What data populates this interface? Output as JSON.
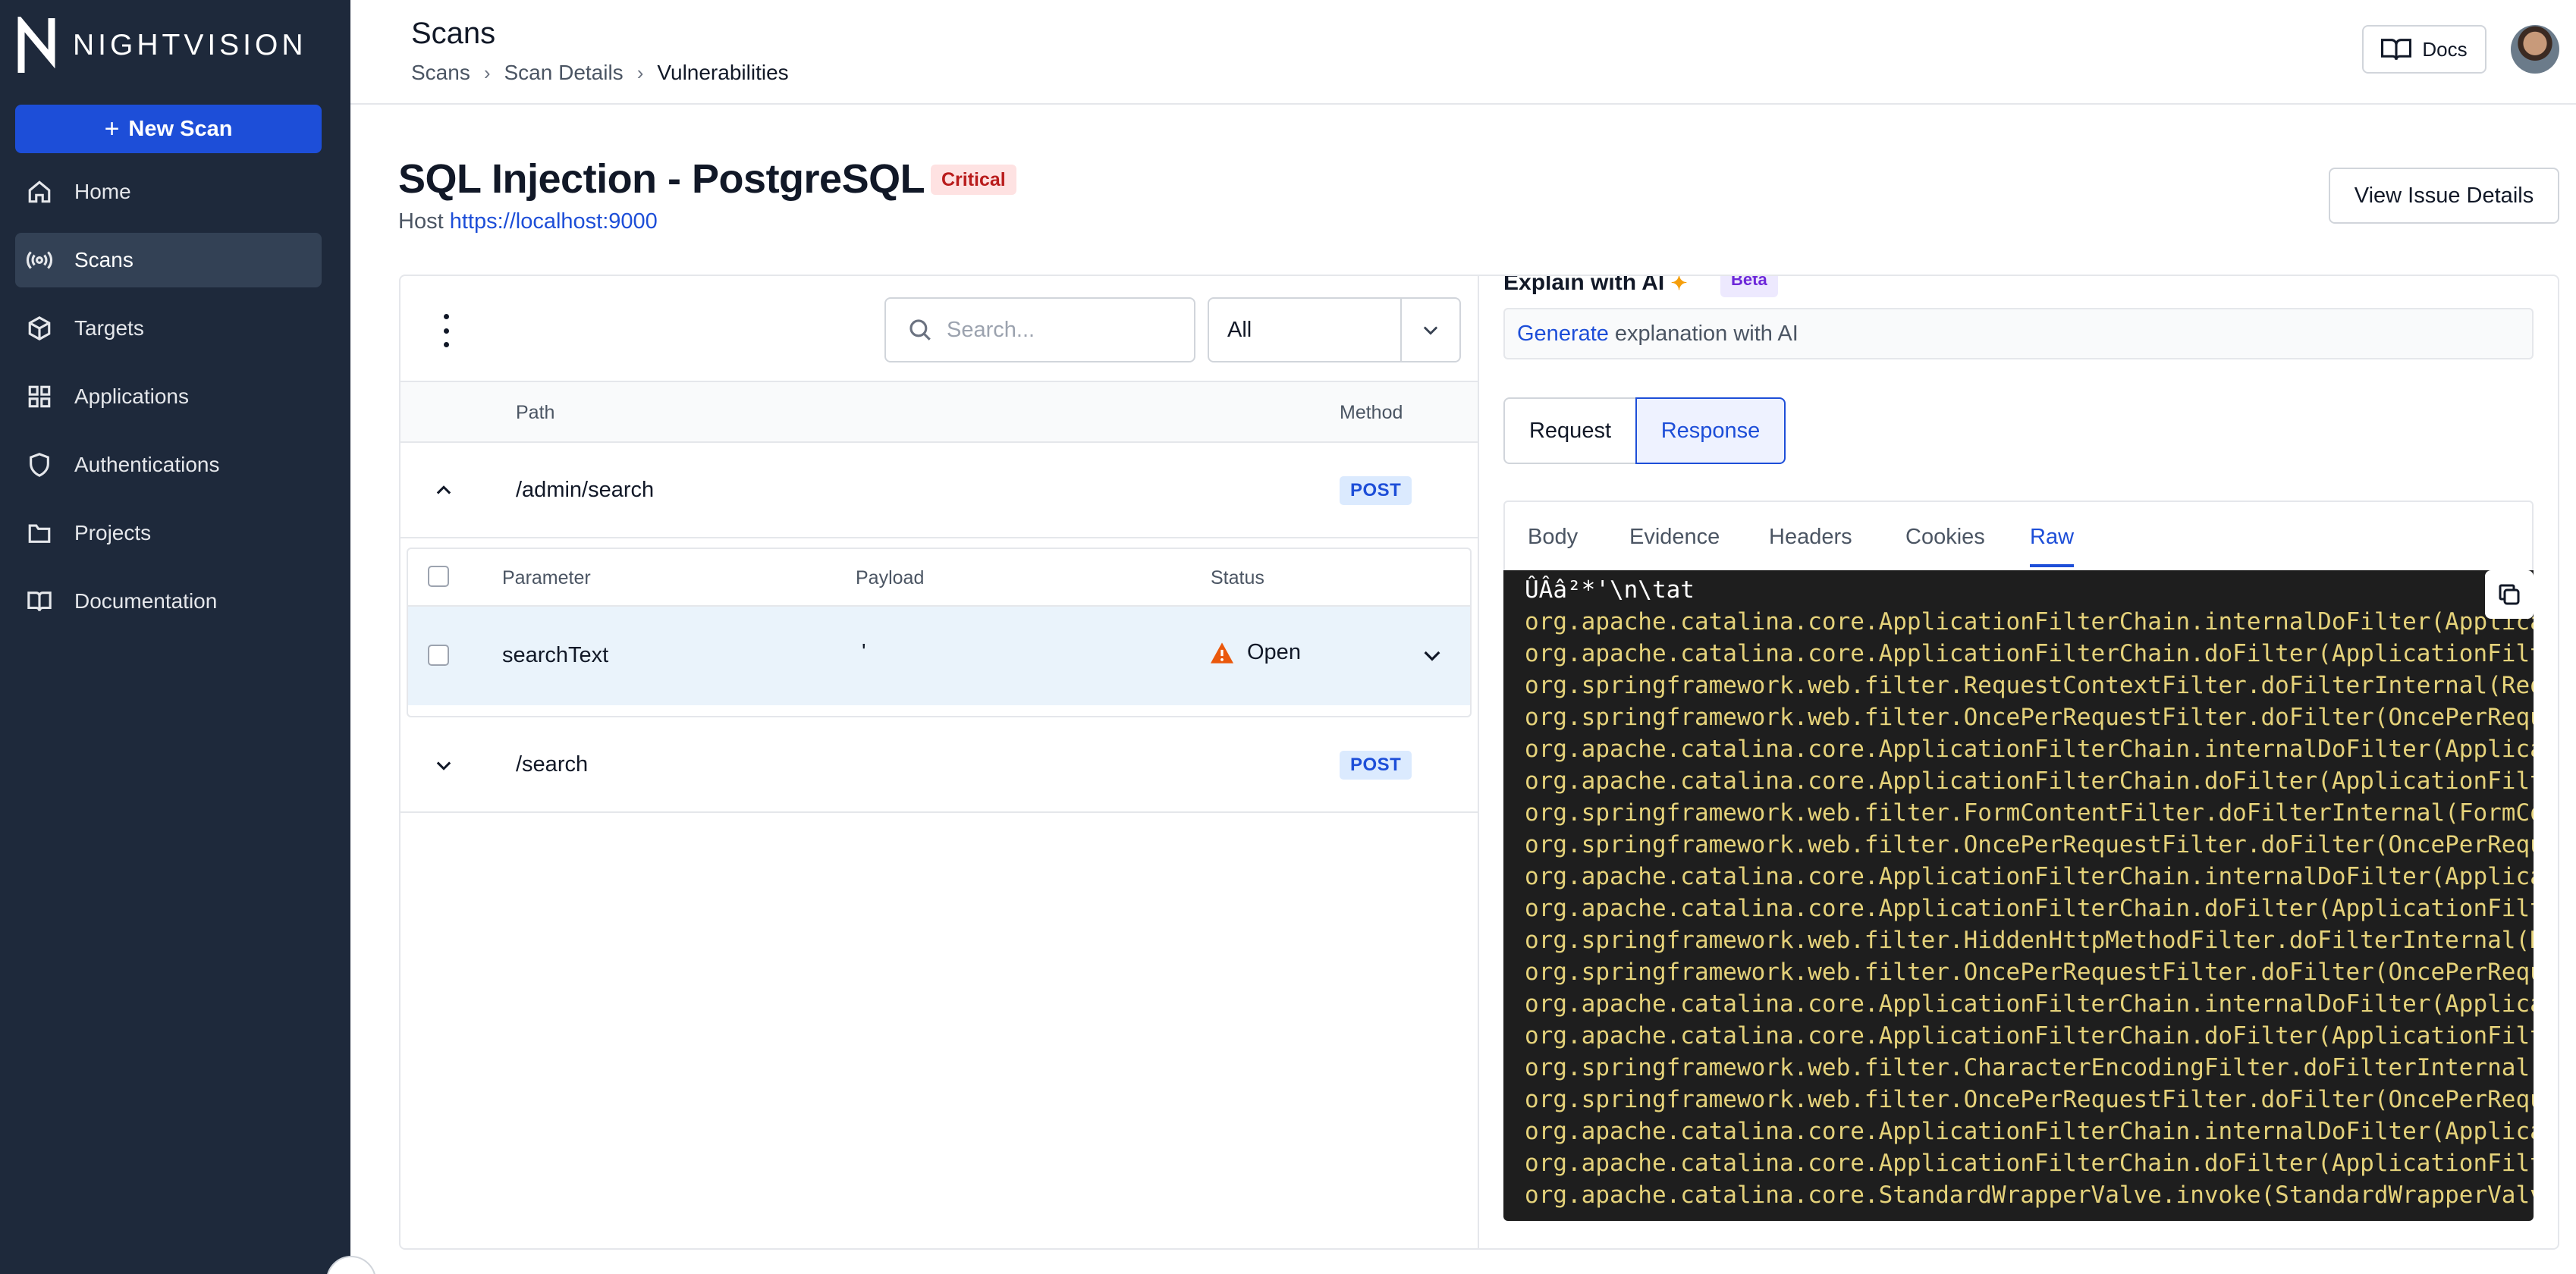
{
  "brand": {
    "name": "NIGHTVISION"
  },
  "sidebar": {
    "new_scan_label": "New Scan",
    "items": [
      {
        "label": "Home",
        "icon": "home-icon"
      },
      {
        "label": "Scans",
        "icon": "broadcast-icon",
        "active": true
      },
      {
        "label": "Targets",
        "icon": "cube-icon"
      },
      {
        "label": "Applications",
        "icon": "grid-icon"
      },
      {
        "label": "Authentications",
        "icon": "shield-icon"
      },
      {
        "label": "Projects",
        "icon": "folder-icon"
      },
      {
        "label": "Documentation",
        "icon": "book-icon"
      }
    ]
  },
  "header": {
    "title": "Scans",
    "breadcrumb": [
      "Scans",
      "Scan Details",
      "Vulnerabilities"
    ],
    "docs_label": "Docs"
  },
  "issue": {
    "title": "SQL Injection - PostgreSQL",
    "severity": "Critical",
    "host_label": "Host",
    "host_url": "https://localhost:9000",
    "view_details_label": "View Issue Details"
  },
  "paths_panel": {
    "search_placeholder": "Search...",
    "filter_value": "All",
    "columns": {
      "path": "Path",
      "method": "Method"
    },
    "rows": [
      {
        "path": "/admin/search",
        "method": "POST",
        "expanded": true
      },
      {
        "path": "/search",
        "method": "POST",
        "expanded": false
      }
    ],
    "sub_columns": {
      "parameter": "Parameter",
      "payload": "Payload",
      "status": "Status"
    },
    "sub_rows": [
      {
        "parameter": "searchText",
        "payload": "'",
        "status": "Open"
      }
    ]
  },
  "detail_panel": {
    "explain_title": "Explain with AI",
    "beta_label": "Beta",
    "generate_link": "Generate",
    "generate_rest": "explanation with AI",
    "toggle": [
      "Request",
      "Response"
    ],
    "active_toggle": "Response",
    "tabs": [
      "Body",
      "Evidence",
      "Headers",
      "Cookies",
      "Raw"
    ],
    "active_tab": "Raw",
    "raw_lines": [
      "ÛÂâ²*'\\n\\tat",
      "org.apache.catalina.core.ApplicationFilterChain.internalDoFilter(ApplicationFil",
      "org.apache.catalina.core.ApplicationFilterChain.doFilter(ApplicationFilterChain",
      "org.springframework.web.filter.RequestContextFilter.doFilterInternal(RequestCon",
      "org.springframework.web.filter.OncePerRequestFilter.doFilter(OncePerRequestFilt",
      "org.apache.catalina.core.ApplicationFilterChain.internalDoFilter(ApplicationFil",
      "org.apache.catalina.core.ApplicationFilterChain.doFilter(ApplicationFilterChain",
      "org.springframework.web.filter.FormContentFilter.doFilterInternal(FormContentFi",
      "org.springframework.web.filter.OncePerRequestFilter.doFilter(OncePerRequestFilt",
      "org.apache.catalina.core.ApplicationFilterChain.internalDoFilter(ApplicationFil",
      "org.apache.catalina.core.ApplicationFilterChain.doFilter(ApplicationFilterChain",
      "org.springframework.web.filter.HiddenHttpMethodFilter.doFilterInternal(HiddenHt",
      "org.springframework.web.filter.OncePerRequestFilter.doFilter(OncePerRequestFilt",
      "org.apache.catalina.core.ApplicationFilterChain.internalDoFilter(ApplicationFil",
      "org.apache.catalina.core.ApplicationFilterChain.doFilter(ApplicationFilterChain",
      "org.springframework.web.filter.CharacterEncodingFilter.doFilterInternal(Charact",
      "org.springframework.web.filter.OncePerRequestFilter.doFilter(OncePerRequestFilt",
      "org.apache.catalina.core.ApplicationFilterChain.internalDoFilter(ApplicationFil",
      "org.apache.catalina.core.ApplicationFilterChain.doFilter(ApplicationFilterChain",
      "org.apache.catalina.core.StandardWrapperValve.invoke(StandardWrapperValve.java:"
    ]
  },
  "colors": {
    "sidebar_bg": "#1e293b",
    "accent": "#1d4ed8",
    "critical": "#b91c1c",
    "code_bg": "#1e1e1e",
    "code_text": "#e5d27a",
    "warning": "#ea580c"
  }
}
